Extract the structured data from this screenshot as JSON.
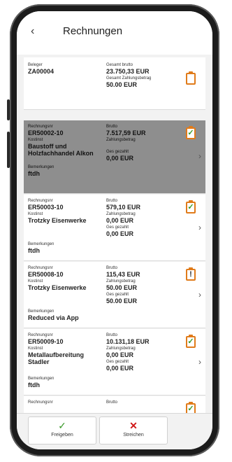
{
  "header": {
    "back_icon": "‹",
    "title": "Rechnungen"
  },
  "cards": [
    {
      "f1_label": "Beleger",
      "f1_value": "ZA00004",
      "f2_label": "Gesamt brutto",
      "f2_value": "23.750,33 EUR",
      "f3_label": "Gesamt Zahlungsbetrag",
      "f3_value": "50.00 EUR",
      "icon": "clipboard-empty-icon"
    },
    {
      "f1_label": "Rechnungsnr",
      "f1_value": "ER50002-10",
      "f2_label": "Kostinst",
      "f2_value": "Baustoff und Holzfachhandel Alkon",
      "f3_label": "Bemerkungen",
      "f3_value": "ftdh",
      "g1_label": "Brutto",
      "g1_value": "7.517,59 EUR",
      "g2_label": "Zahlungsbetrag",
      "g2_value": "",
      "g3_label": "Ges gezahlt",
      "g3_value": "0,00 EUR",
      "icon": "clipboard-check-icon"
    },
    {
      "f1_label": "Rechnungsnr",
      "f1_value": "ER50003-10",
      "f2_label": "Kostinst",
      "f2_value": "Trotzky Eisenwerke",
      "f3_label": "Bemerkungen",
      "f3_value": "ftdh",
      "g1_label": "Brutto",
      "g1_value": "579,10 EUR",
      "g2_label": "Zahlungsbetrag",
      "g2_value": "0,00 EUR",
      "g3_label": "Ges gezahlt",
      "g3_value": "0,00 EUR",
      "icon": "clipboard-check-icon"
    },
    {
      "f1_label": "Rechnungsnr",
      "f1_value": "ER50008-10",
      "f2_label": "Kostinst",
      "f2_value": "Trotzky Eisenwerke",
      "f3_label": "Bemerkungen",
      "f3_value": "Reduced via App",
      "g1_label": "Brutto",
      "g1_value": "115,43 EUR",
      "g2_label": "Zahlungsbetrag",
      "g2_value": "50.00 EUR",
      "g3_label": "Ges gezahlt",
      "g3_value": "50.00 EUR",
      "icon": "clipboard-alert-icon"
    },
    {
      "f1_label": "Rechnungsnr",
      "f1_value": "ER50009-10",
      "f2_label": "Kostinst",
      "f2_value": "Metallaufbereitung Stadler",
      "f3_label": "Bemerkungen",
      "f3_value": "ftdh",
      "g1_label": "Brutto",
      "g1_value": "10.131,18 EUR",
      "g2_label": "Zahlungsbetrag",
      "g2_value": "0,00 EUR",
      "g3_label": "Ges gezahlt",
      "g3_value": "0,00 EUR",
      "icon": "clipboard-check-icon"
    },
    {
      "f1_label": "Rechnungsnr",
      "g1_label": "Brutto",
      "icon": "clipboard-check-icon"
    }
  ],
  "footer": {
    "approve_icon": "✓",
    "approve_label": "Freigeben",
    "delete_icon": "✕",
    "delete_label": "Streichen"
  },
  "colors": {
    "accent_orange": "#e07b1a",
    "check_green": "#3a9a2a",
    "delete_red": "#d01818",
    "selected_row": "#8e8e8e"
  }
}
